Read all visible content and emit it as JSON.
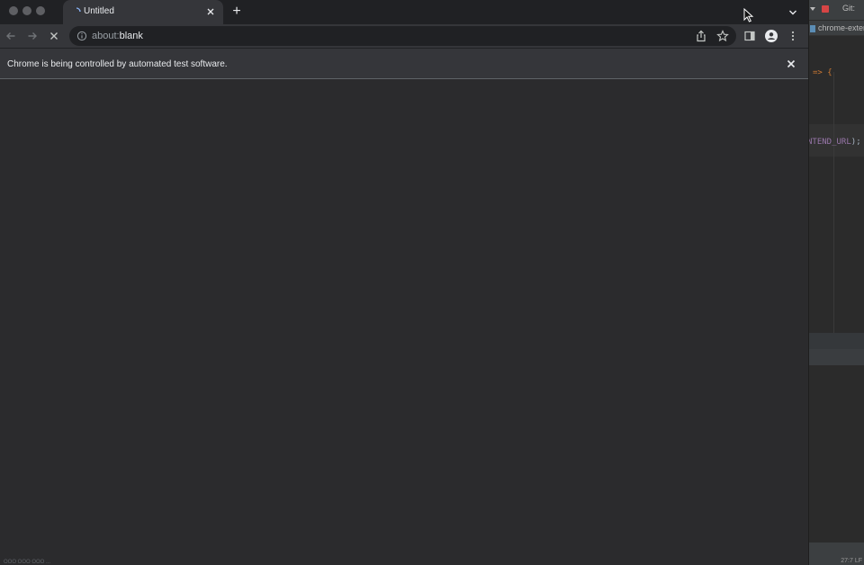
{
  "browser": {
    "tab": {
      "title": "Untitled",
      "close_icon": "close-icon"
    },
    "new_tab_label": "+",
    "address": {
      "scheme": "about:",
      "page": "blank"
    },
    "infobar": {
      "message": "Chrome is being controlled by automated test software."
    },
    "bottom_status": "OOO OOO OOO ..."
  },
  "ide": {
    "git_label": "Git:",
    "file_tab": "chrome-exter",
    "code_line_1": "=> {",
    "code_line_2_const": "NTEND_URL",
    "code_line_2_end": ");",
    "status": "27:7  LF"
  },
  "colors": {
    "tabstrip": "#202124",
    "toolbar": "#35363a",
    "content": "#2b2b2d",
    "text": "#e8eaed"
  }
}
